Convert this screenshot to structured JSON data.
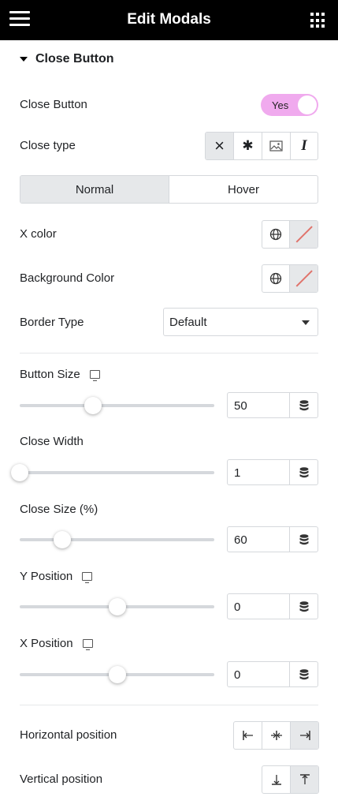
{
  "header": {
    "title": "Edit Modals",
    "menu_icon": "hamburger-menu-icon",
    "apps_icon": "grid-apps-icon"
  },
  "section": {
    "title": "Close Button"
  },
  "close_button": {
    "label": "Close Button",
    "toggle_value": "Yes",
    "toggle_color": "#f0aaee"
  },
  "close_type": {
    "label": "Close type",
    "options": [
      "×",
      "✱",
      "",
      "I"
    ],
    "active_index": 0
  },
  "state_tabs": {
    "normal": "Normal",
    "hover": "Hover",
    "active": "Normal"
  },
  "x_color": {
    "label": "X color"
  },
  "background_color": {
    "label": "Background Color"
  },
  "border_type": {
    "label": "Border Type",
    "value": "Default"
  },
  "button_size": {
    "label": "Button Size",
    "value": "50",
    "slider_fraction": 0.375
  },
  "close_width": {
    "label": "Close Width",
    "value": "1",
    "slider_fraction": 0.0
  },
  "close_size": {
    "label": "Close Size (%)",
    "value": "60",
    "slider_fraction": 0.22
  },
  "y_position": {
    "label": "Y Position",
    "value": "0",
    "slider_fraction": 0.5
  },
  "x_position": {
    "label": "X Position",
    "value": "0",
    "slider_fraction": 0.5
  },
  "horizontal_position": {
    "label": "Horizontal position",
    "options": [
      "left-align-icon",
      "center-align-icon",
      "right-align-icon"
    ],
    "active_index": 2
  },
  "vertical_position": {
    "label": "Vertical position",
    "options": [
      "bottom-align-icon",
      "top-align-icon"
    ],
    "active_index": 1
  }
}
